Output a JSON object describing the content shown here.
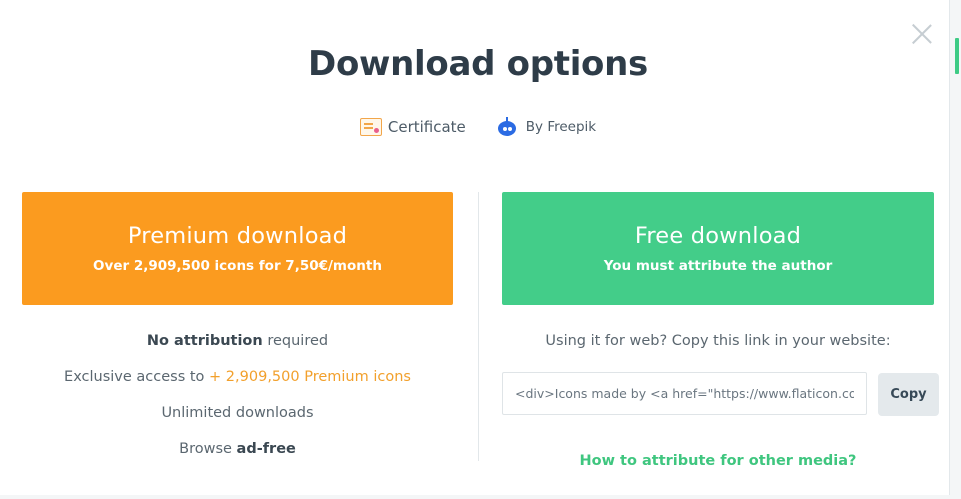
{
  "modal": {
    "title": "Download options",
    "close_icon": "close-icon",
    "meta": {
      "certificate_label": "Certificate",
      "certificate_icon": "certificate-icon",
      "author_label": "By Freepik",
      "author_icon": "freepik-robot-icon"
    }
  },
  "premium": {
    "title": "Premium download",
    "subtitle": "Over 2,909,500 icons for 7,50€/month",
    "color": "#fb9b1f",
    "features": {
      "no_attribution_bold": "No attribution",
      "no_attribution_rest": " required",
      "exclusive_prefix": "Exclusive access to ",
      "exclusive_link": "+ 2,909,500 Premium icons",
      "unlimited": "Unlimited downloads",
      "browse_prefix": "Browse ",
      "browse_bold": "ad-free"
    }
  },
  "free": {
    "title": "Free download",
    "subtitle": "You must attribute the author",
    "color": "#43cd89",
    "copy_hint": "Using it for web? Copy this link in your website:",
    "attribution_value": "<div>Icons made by <a href=\"https://www.flaticon.com/authors/freepik\" title=\"Freepik\">Freepik</a></div>",
    "copy_label": "Copy",
    "attribution_link": "How to attribute for other media?"
  }
}
